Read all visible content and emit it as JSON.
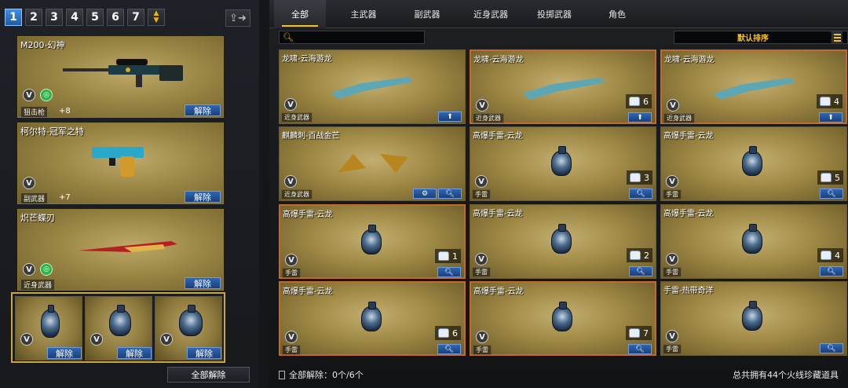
{
  "left": {
    "sets": [
      "1",
      "2",
      "3",
      "4",
      "5",
      "6",
      "7"
    ],
    "active_set": "1",
    "updown_up": "▲",
    "updown_down": "▼",
    "share_icon": "share-icon",
    "weapons": [
      {
        "name": "M200-幻神",
        "category": "狙击枪",
        "ammo": "+8",
        "unequip": "解除"
      },
      {
        "name": "柯尔特-冠军之特",
        "category": "副武器",
        "ammo": "+7",
        "unequip": "解除"
      },
      {
        "name": "炽芒蝶刃",
        "category": "近身武器",
        "unequip": "解除"
      }
    ],
    "throw_slots": [
      {
        "unequip": "解除"
      },
      {
        "unequip": "解除"
      },
      {
        "unequip": "解除"
      }
    ],
    "unequip_all": "全部解除"
  },
  "right": {
    "tabs": [
      "全部",
      "主武器",
      "副武器",
      "近身武器",
      "投掷武器",
      "角色"
    ],
    "active_tab": "全部",
    "search_placeholder": "",
    "sort_label": "默认排序",
    "items": [
      {
        "name": "龙啸-云海游龙",
        "category": "近身武器",
        "action": "up",
        "selected": false
      },
      {
        "name": "龙啸-云海游龙",
        "category": "近身武器",
        "count": "6",
        "action": "up",
        "selected": true
      },
      {
        "name": "龙啸-云海游龙",
        "category": "近身武器",
        "count": "4",
        "action": "up",
        "selected": true
      },
      {
        "name": "麒麟刺-百战金芒",
        "category": "近身武器",
        "action": "search",
        "extra": "gear",
        "selected": false
      },
      {
        "name": "高爆手雷-云龙",
        "category": "手雷",
        "count": "3",
        "action": "search",
        "selected": false
      },
      {
        "name": "高爆手雷-云龙",
        "category": "手雷",
        "count": "5",
        "action": "search",
        "selected": false
      },
      {
        "name": "高爆手雷-云龙",
        "category": "手雷",
        "count": "1",
        "action": "search",
        "selected": true
      },
      {
        "name": "高爆手雷-云龙",
        "category": "手雷",
        "count": "2",
        "action": "search",
        "selected": false
      },
      {
        "name": "高爆手雷-云龙",
        "category": "手雷",
        "count": "4",
        "action": "search",
        "selected": false
      },
      {
        "name": "高爆手雷-云龙",
        "category": "手雷",
        "count": "6",
        "action": "search",
        "selected": true
      },
      {
        "name": "高爆手雷-云龙",
        "category": "手雷",
        "count": "7",
        "action": "search",
        "selected": true
      },
      {
        "name": "手雷-热带奇洋",
        "category": "手雷",
        "action": "search",
        "selected": false
      }
    ],
    "footer_unequip": "全部解除：0个/6个",
    "footer_total": "总共拥有44个火线珍藏道具"
  },
  "colors": {
    "accent": "#f2c12e",
    "select_border": "#c26a2c",
    "button_blue": "#2f66b5"
  }
}
